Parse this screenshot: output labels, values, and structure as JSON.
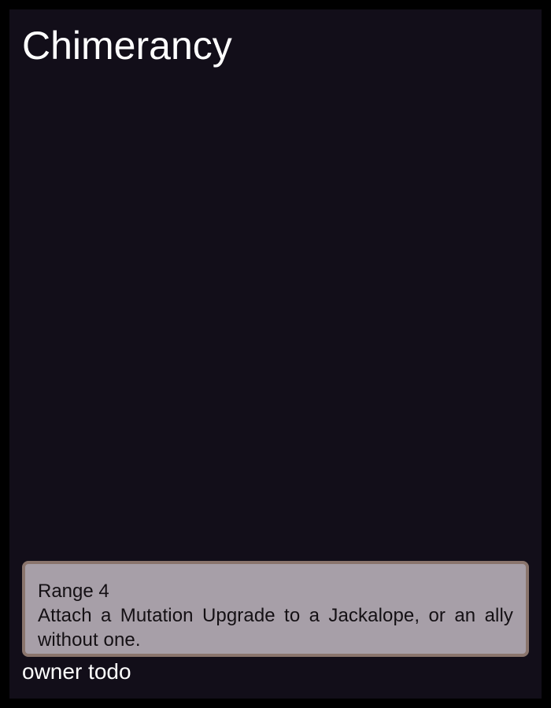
{
  "card": {
    "title": "Chimerancy",
    "range": "Range 4",
    "ability": "Attach a Mutation Upgrade to a Jackalope, or an ally without one.",
    "owner": "owner todo"
  },
  "colors": {
    "page_border": "#000000",
    "card_background": "#120e19",
    "text_box_fill": "#a79fa8",
    "text_box_border": "#8a756d",
    "title_text": "#ffffff",
    "box_text": "#141014"
  }
}
